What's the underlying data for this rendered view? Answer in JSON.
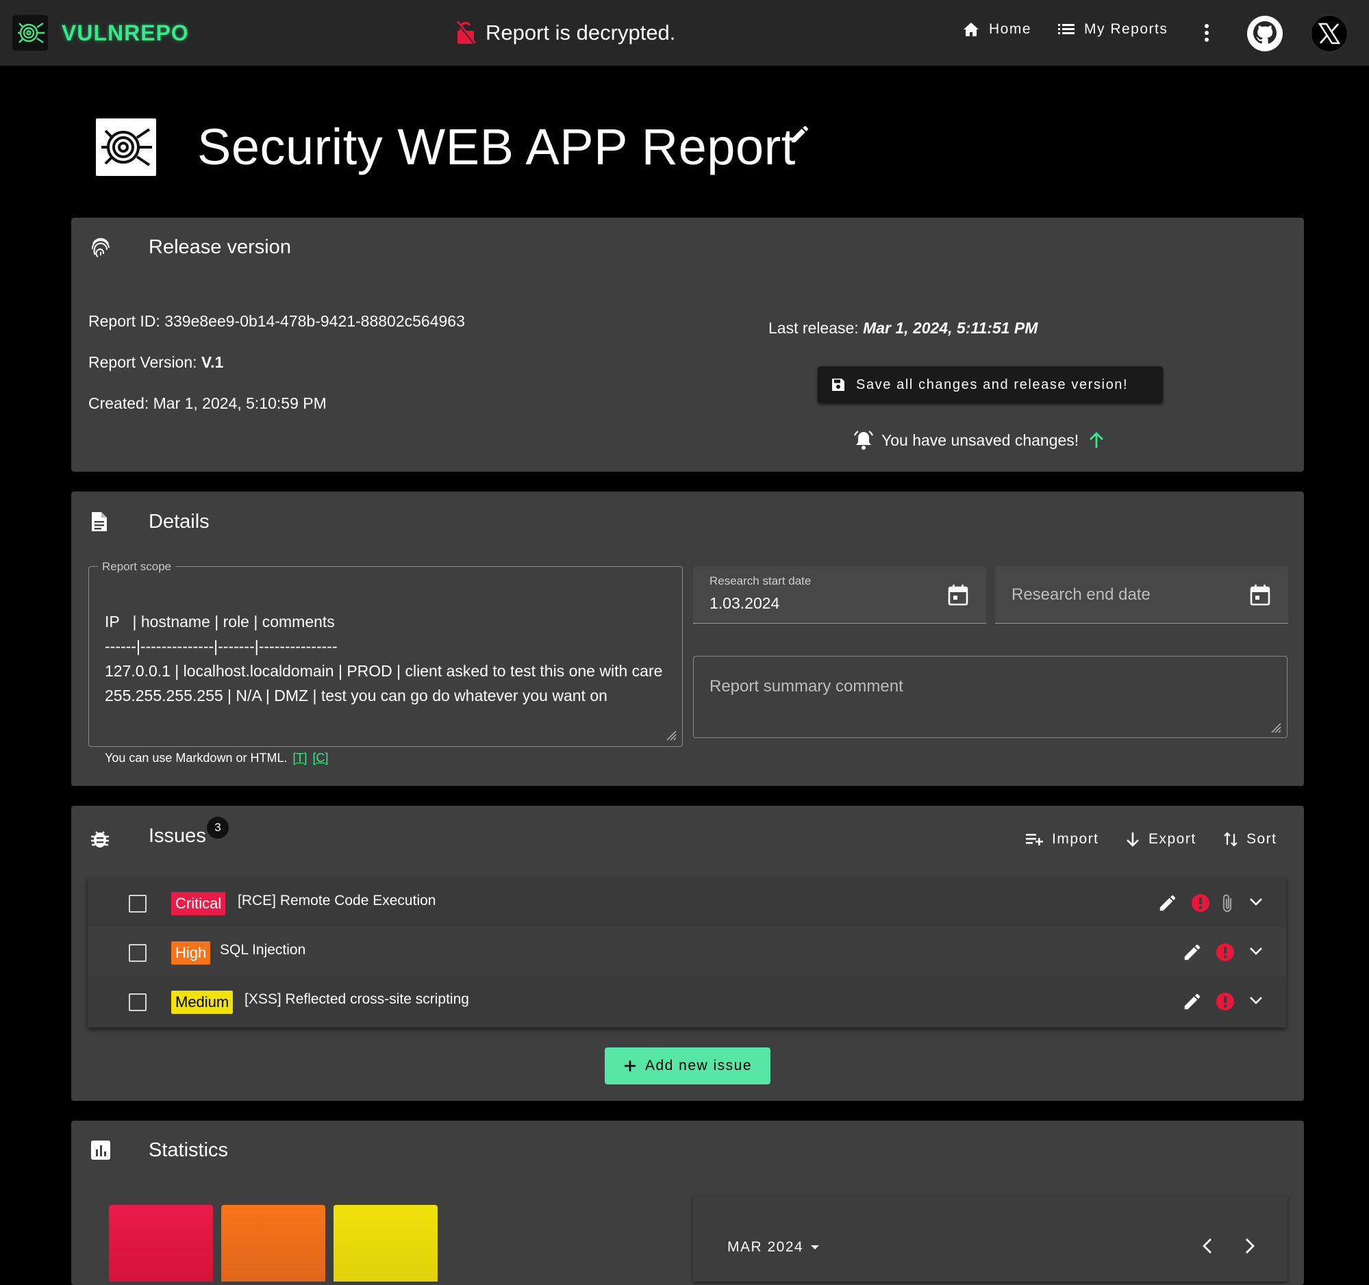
{
  "app": {
    "brand": "VULNREPO",
    "status": "Report is decrypted."
  },
  "nav": {
    "home": "Home",
    "my_reports": "My Reports"
  },
  "report": {
    "title": "Security WEB APP Report"
  },
  "release": {
    "heading": "Release version",
    "report_id_label": "Report ID:",
    "report_id": "339e8ee9-0b14-478b-9421-88802c564963",
    "version_label": "Report Version:",
    "version": "V.1",
    "created_label": "Created:",
    "created": "Mar 1, 2024, 5:10:59 PM",
    "last_release_label": "Last release:",
    "last_release": "Mar 1, 2024, 5:11:51 PM",
    "save_button": "Save all changes and release version!",
    "unsaved_notice": "You have unsaved changes!"
  },
  "details": {
    "heading": "Details",
    "scope_label": "Report scope",
    "scope_value": "IP   | hostname | role | comments\n------|--------------|-------|---------------\n127.0.0.1 | localhost.localdomain | PROD | client asked to test this one with care\n255.255.255.255 | N/A | DMZ | test you can go do whatever you want on",
    "hint": "You can use Markdown or HTML.",
    "hint_t": "[T]",
    "hint_c": "[C]",
    "start_date_label": "Research start date",
    "start_date": "1.03.2024",
    "end_date_placeholder": "Research end date",
    "summary_placeholder": "Report summary comment"
  },
  "issues": {
    "heading": "Issues",
    "count": "3",
    "import": "Import",
    "export": "Export",
    "sort": "Sort",
    "add_button": "Add new issue",
    "items": [
      {
        "severity": "Critical",
        "title": "[RCE] Remote Code Execution",
        "has_attachment": true
      },
      {
        "severity": "High",
        "title": "SQL Injection",
        "has_attachment": false
      },
      {
        "severity": "Medium",
        "title": "[XSS] Reflected cross-site scripting",
        "has_attachment": false
      }
    ]
  },
  "statistics": {
    "heading": "Statistics",
    "tile_colors": [
      "#ea1c47",
      "#f7741a",
      "#f0e20a"
    ],
    "calendar_month": "MAR 2024"
  },
  "colors": {
    "accent": "#3de68a",
    "critical": "#ea1c47",
    "high": "#f7741a",
    "medium": "#f0e20a",
    "add_button": "#58e6a6"
  }
}
